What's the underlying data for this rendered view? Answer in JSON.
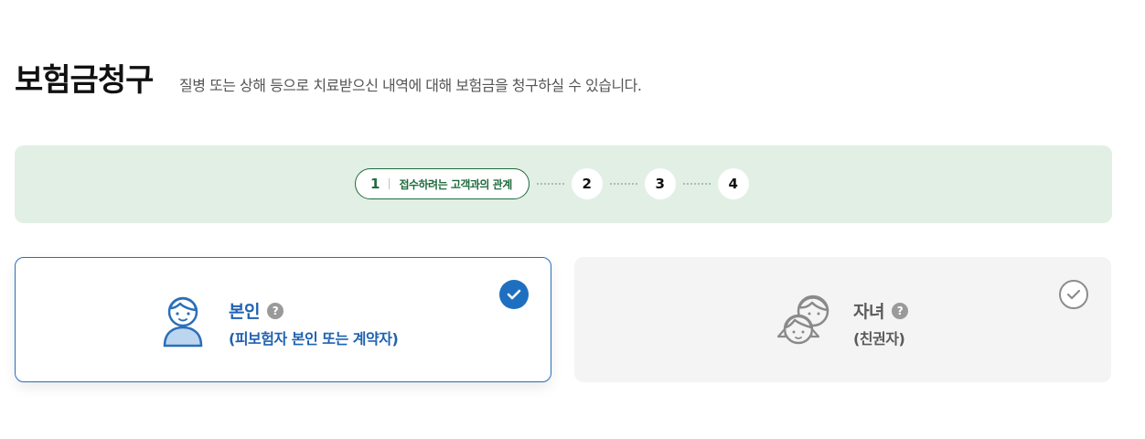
{
  "header": {
    "title": "보험금청구",
    "subtitle": "질병 또는 상해 등으로 치료받으신 내역에 대해 보험금을 청구하실 수 있습니다."
  },
  "steps": {
    "current": {
      "number": "1",
      "label": "접수하려는 고객과의 관계"
    },
    "others": [
      "2",
      "3",
      "4"
    ]
  },
  "options": {
    "self": {
      "name": "본인",
      "help": "?",
      "desc": "(피보험자 본인 또는 계약자)",
      "selected": true,
      "icon": "person-icon"
    },
    "child": {
      "name": "자녀",
      "help": "?",
      "desc": "(친권자)",
      "selected": false,
      "icon": "children-icon"
    }
  },
  "next_section": {
    "title": ""
  },
  "colors": {
    "accent": "#1f6fc0",
    "step_green": "#1f6b3e",
    "stepbar_bg": "#e2efe5",
    "card_inactive_bg": "#f4f4f4"
  }
}
